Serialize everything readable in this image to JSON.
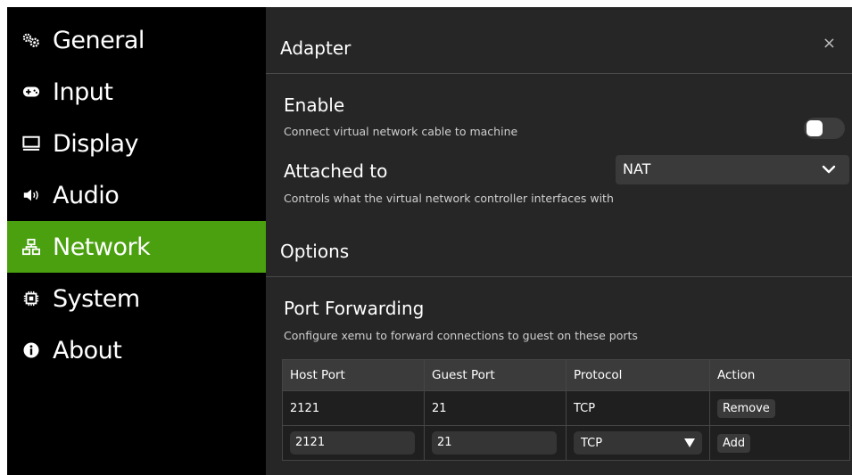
{
  "sidebar": {
    "items": [
      {
        "label": "General",
        "icon": "gears-icon"
      },
      {
        "label": "Input",
        "icon": "gamepad-icon"
      },
      {
        "label": "Display",
        "icon": "monitor-icon"
      },
      {
        "label": "Audio",
        "icon": "speaker-icon"
      },
      {
        "label": "Network",
        "icon": "network-icon",
        "active": true
      },
      {
        "label": "System",
        "icon": "chip-icon"
      },
      {
        "label": "About",
        "icon": "info-icon"
      }
    ],
    "accent_color": "#4aa00f"
  },
  "main": {
    "adapter_title": "Adapter",
    "close_label": "×",
    "enable": {
      "title": "Enable",
      "description": "Connect virtual network cable to machine",
      "on": false
    },
    "attached_to": {
      "title": "Attached to",
      "description": "Controls what the virtual network controller interfaces with",
      "value": "NAT"
    },
    "options_title": "Options",
    "port_forwarding": {
      "title": "Port Forwarding",
      "description": "Configure xemu to forward connections to guest on these ports",
      "columns": [
        "Host Port",
        "Guest Port",
        "Protocol",
        "Action"
      ],
      "rows": [
        {
          "host": "2121",
          "guest": "21",
          "protocol": "TCP",
          "action": "Remove"
        }
      ],
      "new_entry": {
        "host": "2121",
        "guest": "21",
        "protocol": "TCP",
        "action": "Add"
      }
    }
  }
}
